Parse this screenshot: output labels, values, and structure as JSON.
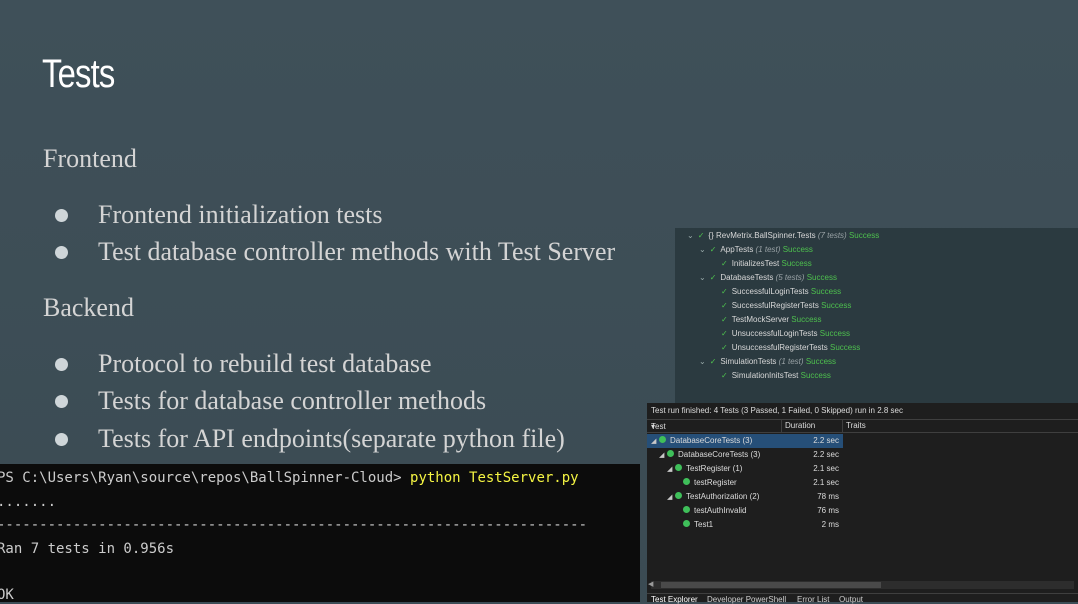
{
  "slide": {
    "title": "Tests",
    "frontend_heading": "Frontend",
    "frontend_items": [
      "Frontend initialization tests",
      "Test database controller methods with Test Server"
    ],
    "backend_heading": "Backend",
    "backend_items": [
      "Protocol to rebuild test database",
      "Tests for database controller methods",
      "Tests for API endpoints(separate python file)"
    ]
  },
  "tree_panel": {
    "rows": [
      {
        "label": "{} RevMetrix.BallSpinner.Tests",
        "meta": "(7 tests)",
        "status": "Success"
      },
      {
        "label": "AppTests",
        "meta": "(1 test)",
        "status": "Success"
      },
      {
        "label": "InitializesTest",
        "meta": "",
        "status": "Success"
      },
      {
        "label": "DatabaseTests",
        "meta": "(5 tests)",
        "status": "Success"
      },
      {
        "label": "SuccessfulLoginTests",
        "meta": "",
        "status": "Success"
      },
      {
        "label": "SuccessfulRegisterTests",
        "meta": "",
        "status": "Success"
      },
      {
        "label": "TestMockServer",
        "meta": "",
        "status": "Success"
      },
      {
        "label": "UnsuccessfulLoginTests",
        "meta": "",
        "status": "Success"
      },
      {
        "label": "UnsuccessfulRegisterTests",
        "meta": "",
        "status": "Success"
      },
      {
        "label": "SimulationTests",
        "meta": "(1 test)",
        "status": "Success"
      },
      {
        "label": "SimulationInitsTest",
        "meta": "",
        "status": "Success"
      }
    ]
  },
  "vs_panel": {
    "summary": "Test run finished: 4 Tests (3 Passed, 1 Failed, 0 Skipped) run in 2.8 sec",
    "columns": {
      "test": "Test",
      "duration": "Duration",
      "traits": "Traits"
    },
    "rows": [
      {
        "name": "DatabaseCoreTests (3)",
        "duration": "2.2 sec"
      },
      {
        "name": "DatabaseCoreTests (3)",
        "duration": "2.2 sec"
      },
      {
        "name": "TestRegister (1)",
        "duration": "2.1 sec"
      },
      {
        "name": "testRegister",
        "duration": "2.1 sec"
      },
      {
        "name": "TestAuthorization (2)",
        "duration": "78 ms"
      },
      {
        "name": "testAuthInvalid",
        "duration": "76 ms"
      },
      {
        "name": "Test1",
        "duration": "2 ms"
      }
    ],
    "tabs": [
      "Test Explorer",
      "Developer PowerShell",
      "Error List",
      "Output"
    ]
  },
  "terminal": {
    "prompt": "PS C:\\Users\\Ryan\\source\\repos\\BallSpinner-Cloud> ",
    "command": "python TestServer.py",
    "dots": ".......",
    "separator": "----------------------------------------------------------------------",
    "result": "Ran 7 tests in 0.956s",
    "status": "OK"
  }
}
